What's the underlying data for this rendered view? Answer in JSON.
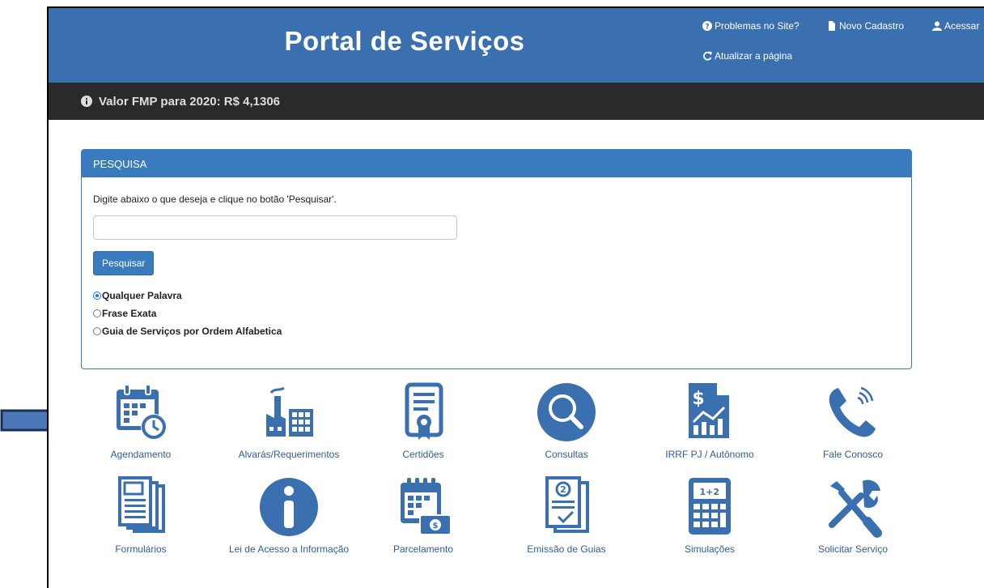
{
  "header": {
    "title": "Portal de Serviços",
    "links": {
      "problemas": "Problemas no Site?",
      "cadastro": "Novo Cadastro",
      "acessar": "Acessar",
      "atualizar": "Atualizar a página"
    }
  },
  "info_bar": {
    "text": "Valor FMP para 2020: R$ 4,1306"
  },
  "search": {
    "panel_title": "PESQUISA",
    "instruction": "Digite abaixo o que deseja e clique no botão 'Pesquisar'.",
    "value": "",
    "placeholder": "",
    "button": "Pesquisar",
    "options": [
      "Qualquer Palavra",
      "Frase Exata",
      "Guia de Serviços por Ordem Alfabetica"
    ],
    "selected": "Qualquer Palavra"
  },
  "services": [
    {
      "label": "Agendamento",
      "icon": "calendar-clock-icon"
    },
    {
      "label": "Alvarás/Requerimentos",
      "icon": "factory-icon"
    },
    {
      "label": "Certidões",
      "icon": "certificate-icon"
    },
    {
      "label": "Consultas",
      "icon": "magnifier-icon"
    },
    {
      "label": "IRRF PJ / Autônomo",
      "icon": "finance-chart-icon"
    },
    {
      "label": "Fale Conosco",
      "icon": "phone-icon"
    },
    {
      "label": "Formulários",
      "icon": "documents-icon"
    },
    {
      "label": "Lei de Acesso a Informação",
      "icon": "info-icon"
    },
    {
      "label": "Parcelamento",
      "icon": "calendar-money-icon"
    },
    {
      "label": "Emissão de Guias",
      "icon": "guide-document-icon"
    },
    {
      "label": "Simulações",
      "icon": "calculator-icon"
    },
    {
      "label": "Solicitar Serviço",
      "icon": "tools-icon"
    }
  ],
  "colors": {
    "header": "#3a70b0",
    "info_bar": "#2a2a2a",
    "accent": "#3a7bbd",
    "icon": "#3a70b0",
    "annotation_arrow": "#4a78b8"
  }
}
